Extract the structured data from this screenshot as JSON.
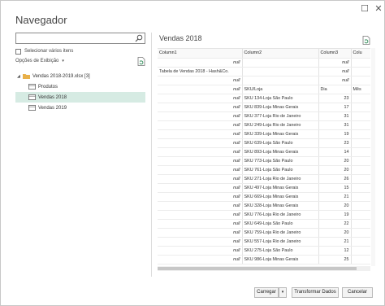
{
  "window": {
    "maximize_glyph": "☐",
    "close_glyph": "✕"
  },
  "navigator": {
    "title": "Navegador",
    "search_placeholder": "",
    "multi_select_label": "Selecionar vários itens",
    "view_options_label": "Opções de Exibição",
    "view_options_caret": "▾",
    "tree": {
      "expander": "◢",
      "file_label": "Vendas 2018-2019.xlsx [3]",
      "items": [
        "Produtos",
        "Vendas 2018",
        "Vendas 2019"
      ],
      "selected_index": 1
    }
  },
  "preview": {
    "title": "Vendas 2018",
    "columns": [
      "Column1",
      "Column2",
      "Column3",
      "Colu"
    ],
    "rows": [
      [
        "null",
        "",
        "null",
        "n"
      ],
      [
        "Tabela de Vendas 2018 - Hash&Co.",
        "",
        "null",
        "n"
      ],
      [
        "null",
        "",
        "null",
        "n"
      ],
      [
        "null",
        "SKU/Loja",
        "Dia",
        "Mês"
      ],
      [
        "null",
        "SKU 134-Loja São Paulo",
        "23",
        ""
      ],
      [
        "null",
        "SKU 839-Loja Minas Gerais",
        "17",
        ""
      ],
      [
        "null",
        "SKU 377-Loja Rio de Janeiro",
        "31",
        ""
      ],
      [
        "null",
        "SKU 249-Loja Rio de Janeiro",
        "31",
        ""
      ],
      [
        "null",
        "SKU 339-Loja Minas Gerais",
        "19",
        ""
      ],
      [
        "null",
        "SKU 639-Loja São Paulo",
        "23",
        ""
      ],
      [
        "null",
        "SKU 893-Loja Minas Gerais",
        "14",
        ""
      ],
      [
        "null",
        "SKU 773-Loja São Paulo",
        "20",
        ""
      ],
      [
        "null",
        "SKU 761-Loja São Paulo",
        "20",
        ""
      ],
      [
        "null",
        "SKU 271-Loja Rio de Janeiro",
        "26",
        ""
      ],
      [
        "null",
        "SKU 497-Loja Minas Gerais",
        "15",
        ""
      ],
      [
        "null",
        "SKU 669-Loja Minas Gerais",
        "21",
        ""
      ],
      [
        "null",
        "SKU 328-Loja Minas Gerais",
        "20",
        ""
      ],
      [
        "null",
        "SKU 776-Loja Rio de Janeiro",
        "19",
        ""
      ],
      [
        "null",
        "SKU 649-Loja São Paulo",
        "22",
        ""
      ],
      [
        "null",
        "SKU 759-Loja Rio de Janeiro",
        "20",
        ""
      ],
      [
        "null",
        "SKU 557-Loja Rio de Janeiro",
        "21",
        ""
      ],
      [
        "null",
        "SKU 275-Loja São Paulo",
        "12",
        ""
      ],
      [
        "null",
        "SKU 986-Loja Minas Gerais",
        "25",
        ""
      ]
    ]
  },
  "buttons": {
    "load": "Carregar",
    "load_arrow": "▾",
    "transform": "Transformar Dados",
    "cancel": "Cancelar"
  }
}
